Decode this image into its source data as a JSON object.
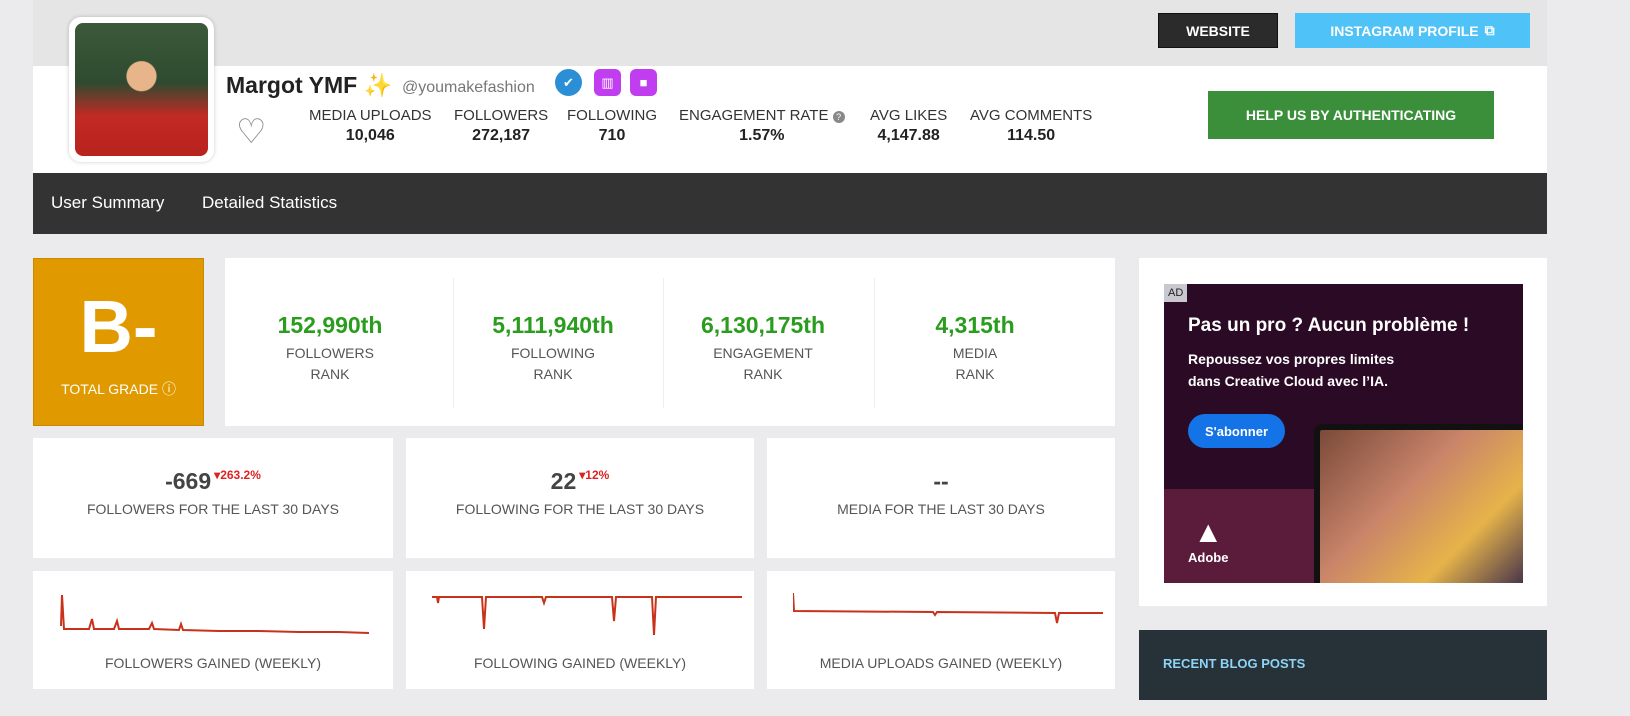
{
  "header": {
    "website_label": "WEBSITE",
    "instagram_label": "INSTAGRAM PROFILE",
    "auth_label": "HELP US BY AUTHENTICATING",
    "name": "Margot YMF ✨",
    "handle": "@youmakefashion",
    "stats": [
      {
        "label": "MEDIA UPLOADS",
        "value": "10,046"
      },
      {
        "label": "FOLLOWERS",
        "value": "272,187"
      },
      {
        "label": "FOLLOWING",
        "value": "710"
      },
      {
        "label": "ENGAGEMENT RATE",
        "value": "1.57%"
      },
      {
        "label": "AVG LIKES",
        "value": "4,147.88"
      },
      {
        "label": "AVG COMMENTS",
        "value": "114.50"
      }
    ]
  },
  "nav": {
    "tabs": [
      "User Summary",
      "Detailed Statistics"
    ]
  },
  "grade": {
    "value": "B-",
    "label": "TOTAL GRADE"
  },
  "ranks": [
    {
      "value": "152,990th",
      "label": "FOLLOWERS",
      "sub": "RANK"
    },
    {
      "value": "5,111,940th",
      "label": "FOLLOWING",
      "sub": "RANK"
    },
    {
      "value": "6,130,175th",
      "label": "ENGAGEMENT",
      "sub": "RANK"
    },
    {
      "value": "4,315th",
      "label": "MEDIA",
      "sub": "RANK"
    }
  ],
  "last30": [
    {
      "value": "-669",
      "change": "263.2%",
      "label": "FOLLOWERS FOR THE LAST 30 DAYS"
    },
    {
      "value": "22",
      "change": "12%",
      "label": "FOLLOWING FOR THE LAST 30 DAYS"
    },
    {
      "value": "--",
      "change": "",
      "label": "MEDIA FOR THE LAST 30 DAYS"
    }
  ],
  "sparks": [
    {
      "label": "FOLLOWERS GAINED (WEEKLY)"
    },
    {
      "label": "FOLLOWING GAINED (WEEKLY)"
    },
    {
      "label": "MEDIA UPLOADS GAINED (WEEKLY)"
    }
  ],
  "ad": {
    "tag": "AD",
    "headline": "Pas un pro ? Aucun problème !",
    "line1": "Repoussez vos propres limites",
    "line2": "dans Creative Cloud avec l’IA.",
    "cta": "S'abonner",
    "brand": "Adobe"
  },
  "blog": {
    "title": "RECENT BLOG POSTS"
  },
  "colors": {
    "grade": "#e09a00",
    "rank": "#2a9d1e",
    "auth": "#3b8f3b",
    "insta": "#4fc3f7",
    "spark": "#c8321a"
  }
}
